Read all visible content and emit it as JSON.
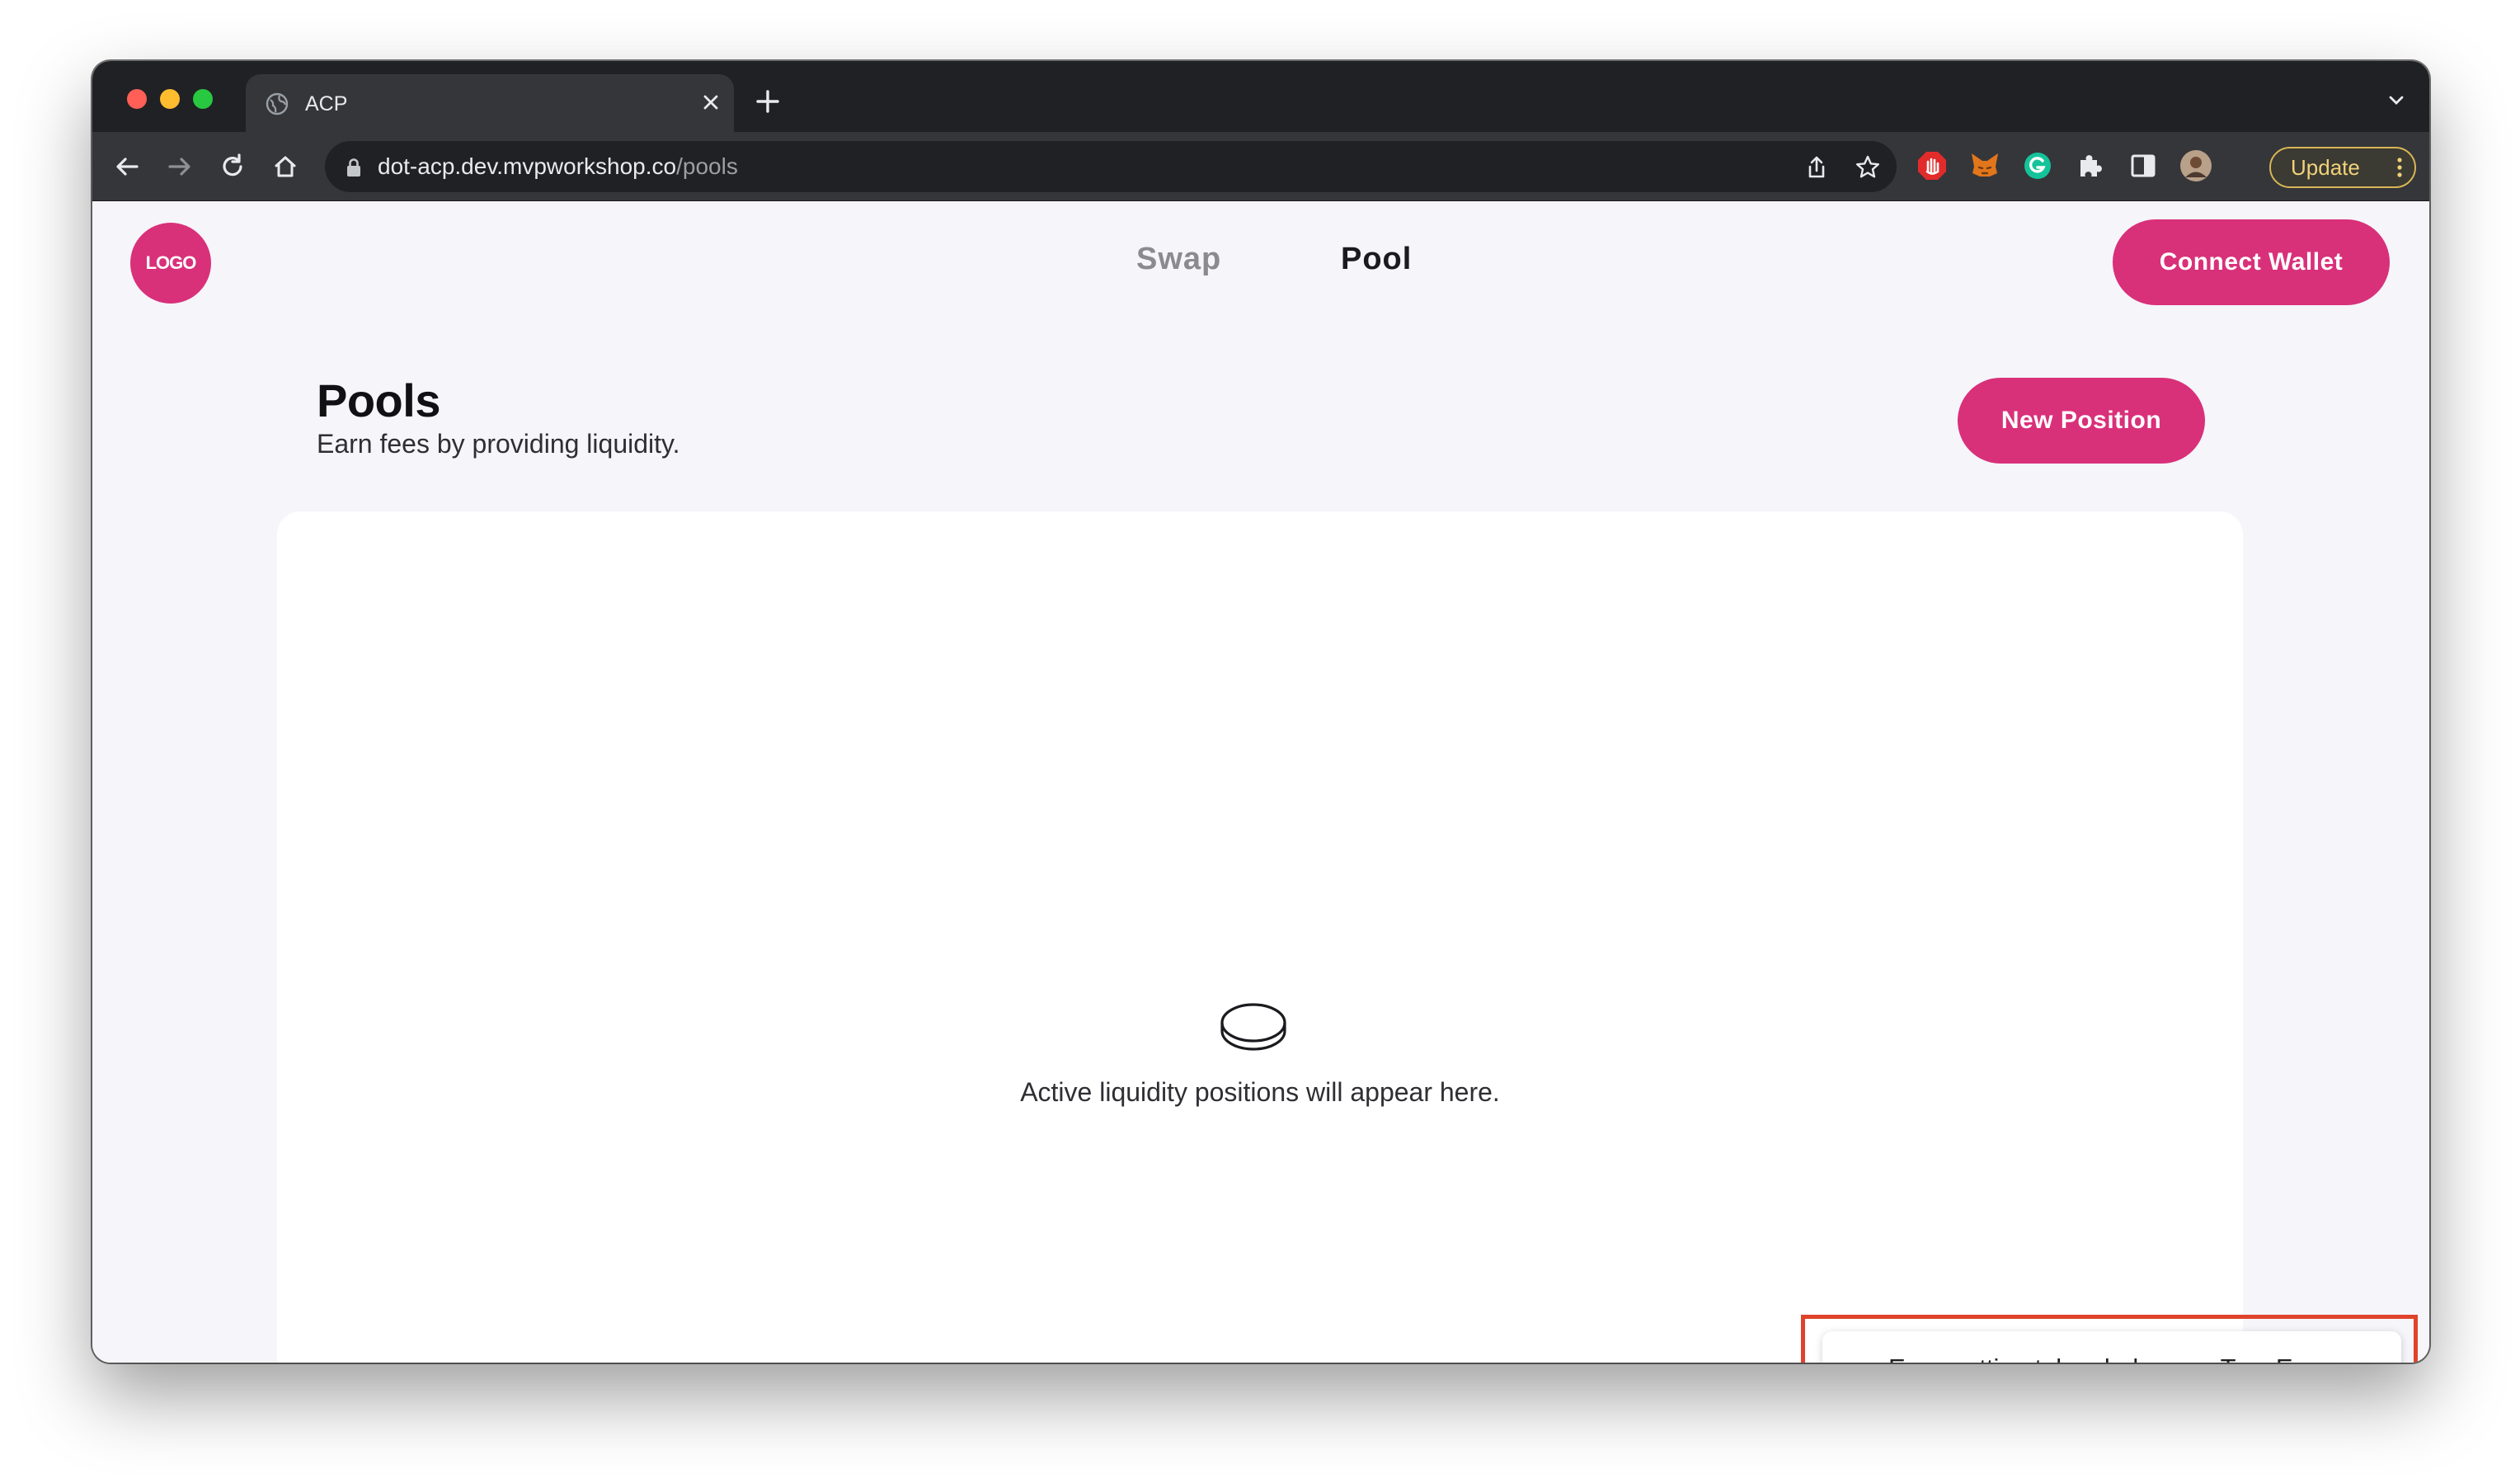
{
  "browser": {
    "tab_title": "ACP",
    "url_host": "dot-acp.dev.mvpworkshop.co",
    "url_path": "/pools",
    "update_label": "Update"
  },
  "header": {
    "logo_text": "LOGO",
    "nav": [
      {
        "label": "Swap",
        "active": false
      },
      {
        "label": "Pool",
        "active": true
      }
    ],
    "connect_label": "Connect Wallet"
  },
  "pools": {
    "title": "Pools",
    "subtitle": "Earn fees by providing liquidity.",
    "new_position_label": "New Position",
    "empty_message": "Active liquidity positions will appear here."
  },
  "toast": {
    "message": "Error setting token balances: TypeError: Cannot read properties of undefined (reading 'address')",
    "type": "error"
  },
  "colors": {
    "brand": "#d9307a",
    "error": "#e0432b"
  }
}
